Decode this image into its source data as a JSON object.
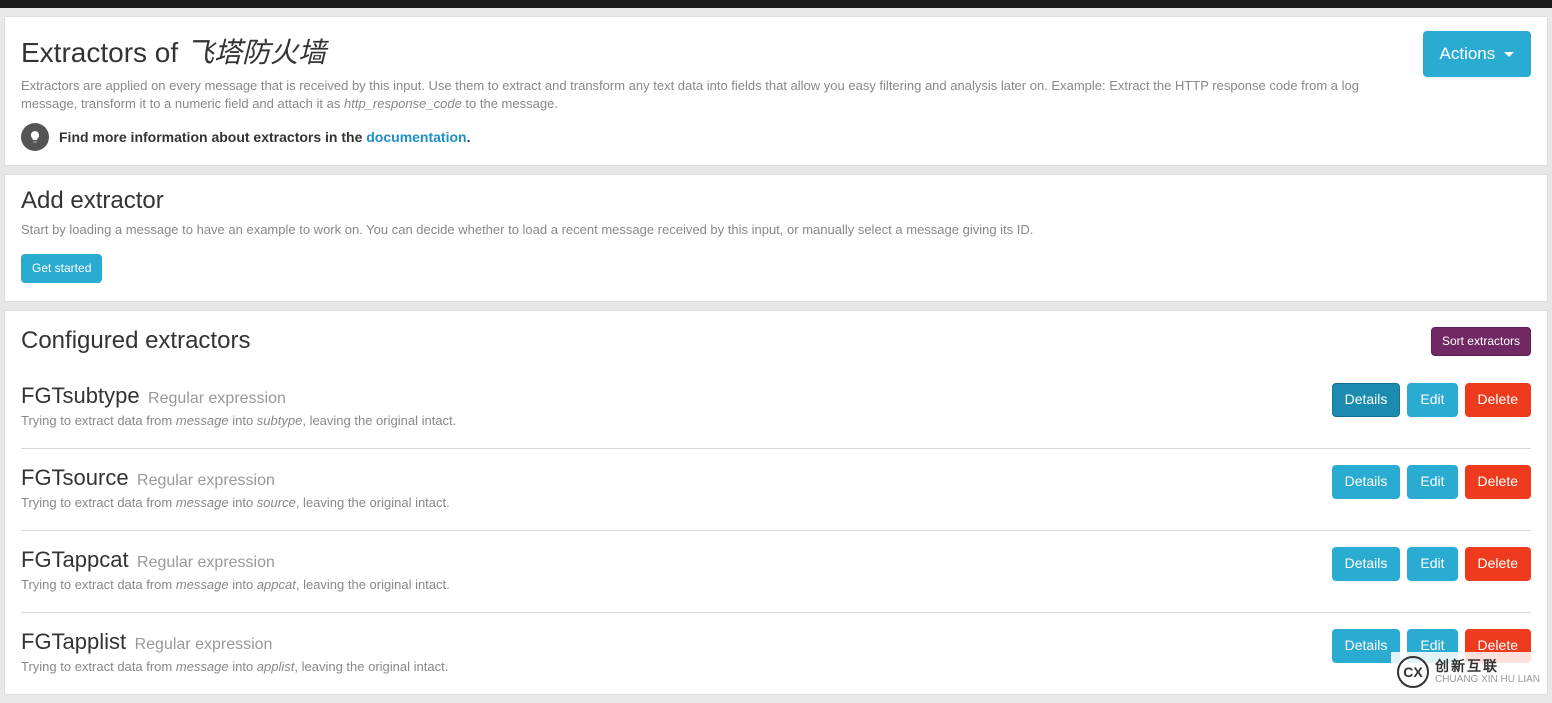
{
  "header": {
    "title_prefix": "Extractors of ",
    "title_input_name": "飞塔防火墙",
    "description_part1": "Extractors are applied on every message that is received by this input. Use them to extract and transform any text data into fields that allow you easy filtering and analysis later on. Example: Extract the HTTP response code from a log message, transform it to a numeric field and attach it as ",
    "description_code": "http_response_code",
    "description_part2": " to the message.",
    "callout_prefix": "Find more information about extractors in the ",
    "callout_link": "documentation",
    "callout_suffix": ".",
    "actions_label": "Actions"
  },
  "add_section": {
    "title": "Add extractor",
    "description": "Start by loading a message to have an example to work on. You can decide whether to load a recent message received by this input, or manually select a message giving its ID.",
    "get_started_label": "Get started"
  },
  "configured_section": {
    "title": "Configured extractors",
    "sort_label": "Sort extractors",
    "buttons": {
      "details": "Details",
      "edit": "Edit",
      "delete": "Delete"
    },
    "extractors": [
      {
        "name": "FGTsubtype",
        "type": "Regular expression",
        "desc_pre": "Trying to extract data from ",
        "desc_src": "message",
        "desc_mid": " into ",
        "desc_dst": "subtype",
        "desc_post": ", leaving the original intact.",
        "details_active": true
      },
      {
        "name": "FGTsource",
        "type": "Regular expression",
        "desc_pre": "Trying to extract data from ",
        "desc_src": "message",
        "desc_mid": " into ",
        "desc_dst": "source",
        "desc_post": ", leaving the original intact.",
        "details_active": false
      },
      {
        "name": "FGTappcat",
        "type": "Regular expression",
        "desc_pre": "Trying to extract data from ",
        "desc_src": "message",
        "desc_mid": " into ",
        "desc_dst": "appcat",
        "desc_post": ", leaving the original intact.",
        "details_active": false
      },
      {
        "name": "FGTapplist",
        "type": "Regular expression",
        "desc_pre": "Trying to extract data from ",
        "desc_src": "message",
        "desc_mid": " into ",
        "desc_dst": "applist",
        "desc_post": ", leaving the original intact.",
        "details_active": false
      }
    ]
  },
  "watermark": {
    "zh": "创新互联",
    "en": "CHUANG XIN HU LIAN",
    "logo": "CX"
  }
}
